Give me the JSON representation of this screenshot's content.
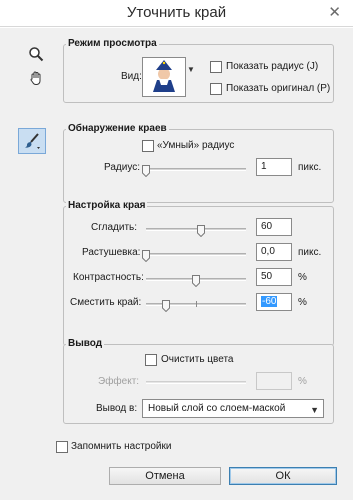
{
  "window": {
    "title": "Уточнить край"
  },
  "view_mode": {
    "title": "Режим просмотра",
    "view_label": "Вид:",
    "show_radius": "Показать радиус (J)",
    "show_original": "Показать оригинал (P)"
  },
  "edge_detection": {
    "title": "Обнаружение краев",
    "smart_radius": "«Умный» радиус",
    "radius_label": "Радиус:",
    "radius_value": "1",
    "unit": "пикс."
  },
  "adjust_edge": {
    "title": "Настройка края",
    "smooth_label": "Сгладить:",
    "smooth_value": "60",
    "smooth_level": 0.55,
    "feather_label": "Растушевка:",
    "feather_value": "0,0",
    "feather_unit": "пикс.",
    "feather_level": 0.0,
    "contrast_label": "Контрастность:",
    "contrast_value": "50",
    "contrast_unit": "%",
    "contrast_level": 0.5,
    "shift_label": "Сместить край:",
    "shift_value": "-60",
    "shift_unit": "%",
    "shift_level": 0.2
  },
  "output": {
    "title": "Вывод",
    "decontaminate": "Очистить цвета",
    "amount_label": "Эффект:",
    "amount_unit": "%",
    "output_to_label": "Вывод в:",
    "output_to_value": "Новый слой со слоем-маской"
  },
  "remember": "Запомнить настройки",
  "buttons": {
    "cancel": "Отмена",
    "ok": "ОК"
  }
}
